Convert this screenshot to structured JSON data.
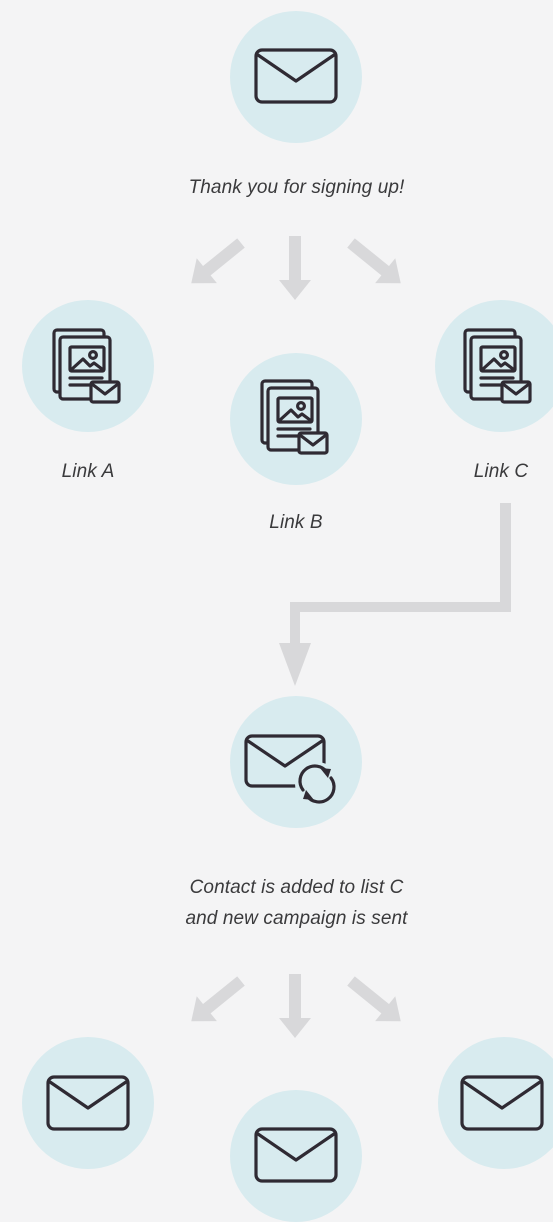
{
  "diagram": {
    "colors": {
      "background": "#f4f4f5",
      "circle_fill": "#d8ebef",
      "icon_stroke": "#2f2a33",
      "arrow": "#d8d8da",
      "text": "#3a3a3c"
    },
    "stage1": {
      "icon": "envelope-icon",
      "caption": "Thank you for signing up!"
    },
    "links": [
      {
        "icon": "newsletter-icon",
        "label": "Link A"
      },
      {
        "icon": "newsletter-icon",
        "label": "Link B"
      },
      {
        "icon": "newsletter-icon",
        "label": "Link C"
      }
    ],
    "stage2": {
      "icon": "envelope-sync-icon",
      "caption_line1": "Contact is added to list C",
      "caption_line2": "and new campaign is sent"
    },
    "outputs": [
      {
        "icon": "envelope-icon"
      },
      {
        "icon": "envelope-icon"
      },
      {
        "icon": "envelope-icon"
      }
    ]
  }
}
